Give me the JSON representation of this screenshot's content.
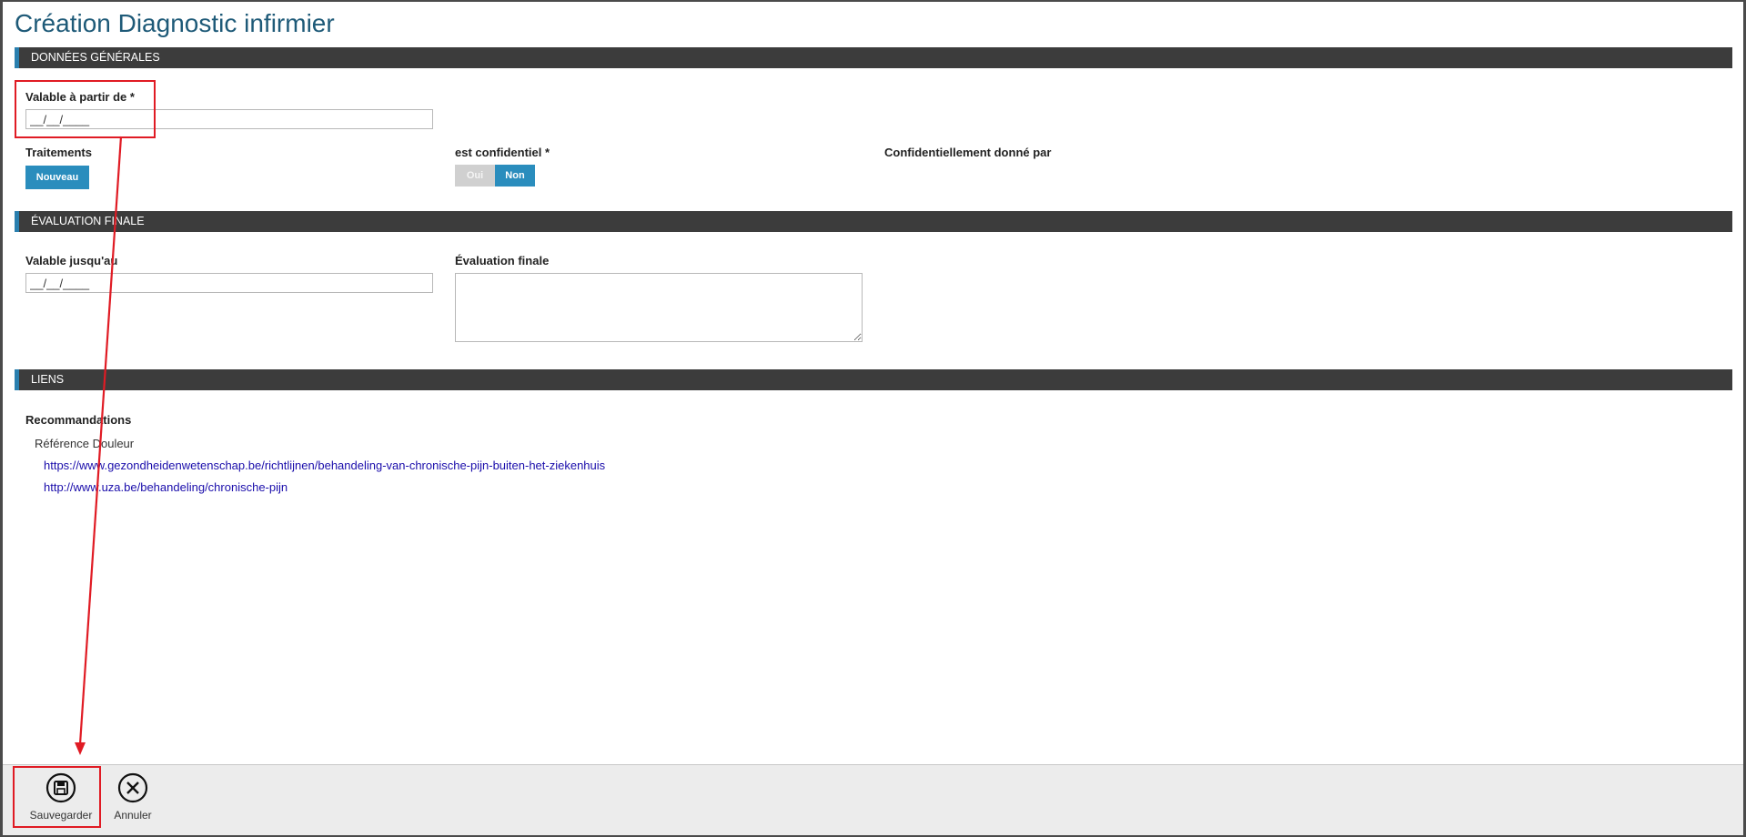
{
  "page": {
    "title": "Création Diagnostic infirmier"
  },
  "sections": {
    "general": "DONNÉES GÉNÉRALES",
    "final": "ÉVALUATION FINALE",
    "links": "LIENS"
  },
  "general": {
    "valid_from_label": "Valable à partir de *",
    "valid_from_value": "__/__/____",
    "treatments_label": "Traitements",
    "new_button": "Nouveau",
    "confidential_label": "est confidentiel *",
    "toggle_yes": "Oui",
    "toggle_no": "Non",
    "toggle_selected": "Non",
    "confidential_by_label": "Confidentiellement donné par"
  },
  "final": {
    "valid_until_label": "Valable jusqu'au",
    "valid_until_value": "__/__/____",
    "evaluation_label": "Évaluation finale"
  },
  "links": {
    "recommendations_label": "Recommandations",
    "reference_title": "Référence Douleur",
    "urls": [
      "https://www.gezondheidenwetenschap.be/richtlijnen/behandeling-van-chronische-pijn-buiten-het-ziekenhuis",
      "http://www.uza.be/behandeling/chronische-pijn"
    ]
  },
  "footer": {
    "save_label": "Sauvegarder",
    "cancel_label": "Annuler"
  },
  "colors": {
    "accent": "#2a8dbd",
    "title": "#1e5a78",
    "section_bar": "#3c3c3c",
    "annotation": "#e01b24"
  },
  "icons": {
    "save": "floppy-disk-icon",
    "cancel": "close-circle-icon"
  }
}
